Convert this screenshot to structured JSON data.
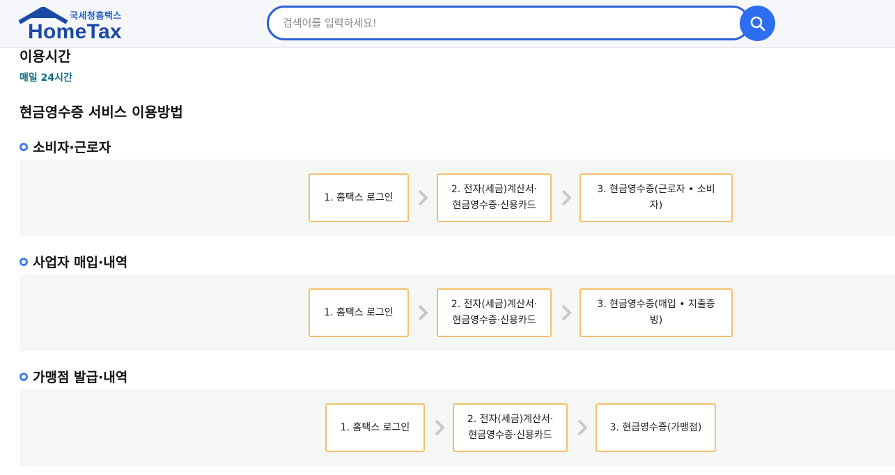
{
  "header": {
    "logo_kr": "국세청홈택스",
    "logo_en": "HomeTax",
    "search_placeholder": "검색어를 입력하세요!"
  },
  "usage_time": {
    "title": "이용시간",
    "value": "매일 24시간"
  },
  "method_title": "현금영수증 서비스 이용방법",
  "sections": [
    {
      "title": "소비자·근로자",
      "steps": [
        "1. 홈택스 로그인",
        "2. 전자(세금)계산서·\n현금영수증·신용카드",
        "3. 현금영수증(근로자 • 소비\n자)"
      ]
    },
    {
      "title": "사업자 매입·내역",
      "steps": [
        "1. 홈택스 로그인",
        "2. 전자(세금)계산서·\n현금영수증·신용카드",
        "3. 현금영수증(매입 • 지출증\n빙)"
      ]
    },
    {
      "title": "가맹점 발급·내역",
      "steps": [
        "1. 홈택스 로그인",
        "2. 전자(세금)계산서·\n현금영수증·신용카드",
        "3. 현금영수증(가맹점)"
      ]
    }
  ],
  "colors": {
    "brand_blue": "#1b4aa6",
    "search_border": "#2b5fd9",
    "search_button": "#2d6ef0",
    "step_border": "#f5c06a",
    "usage_value": "#0f6b86"
  }
}
